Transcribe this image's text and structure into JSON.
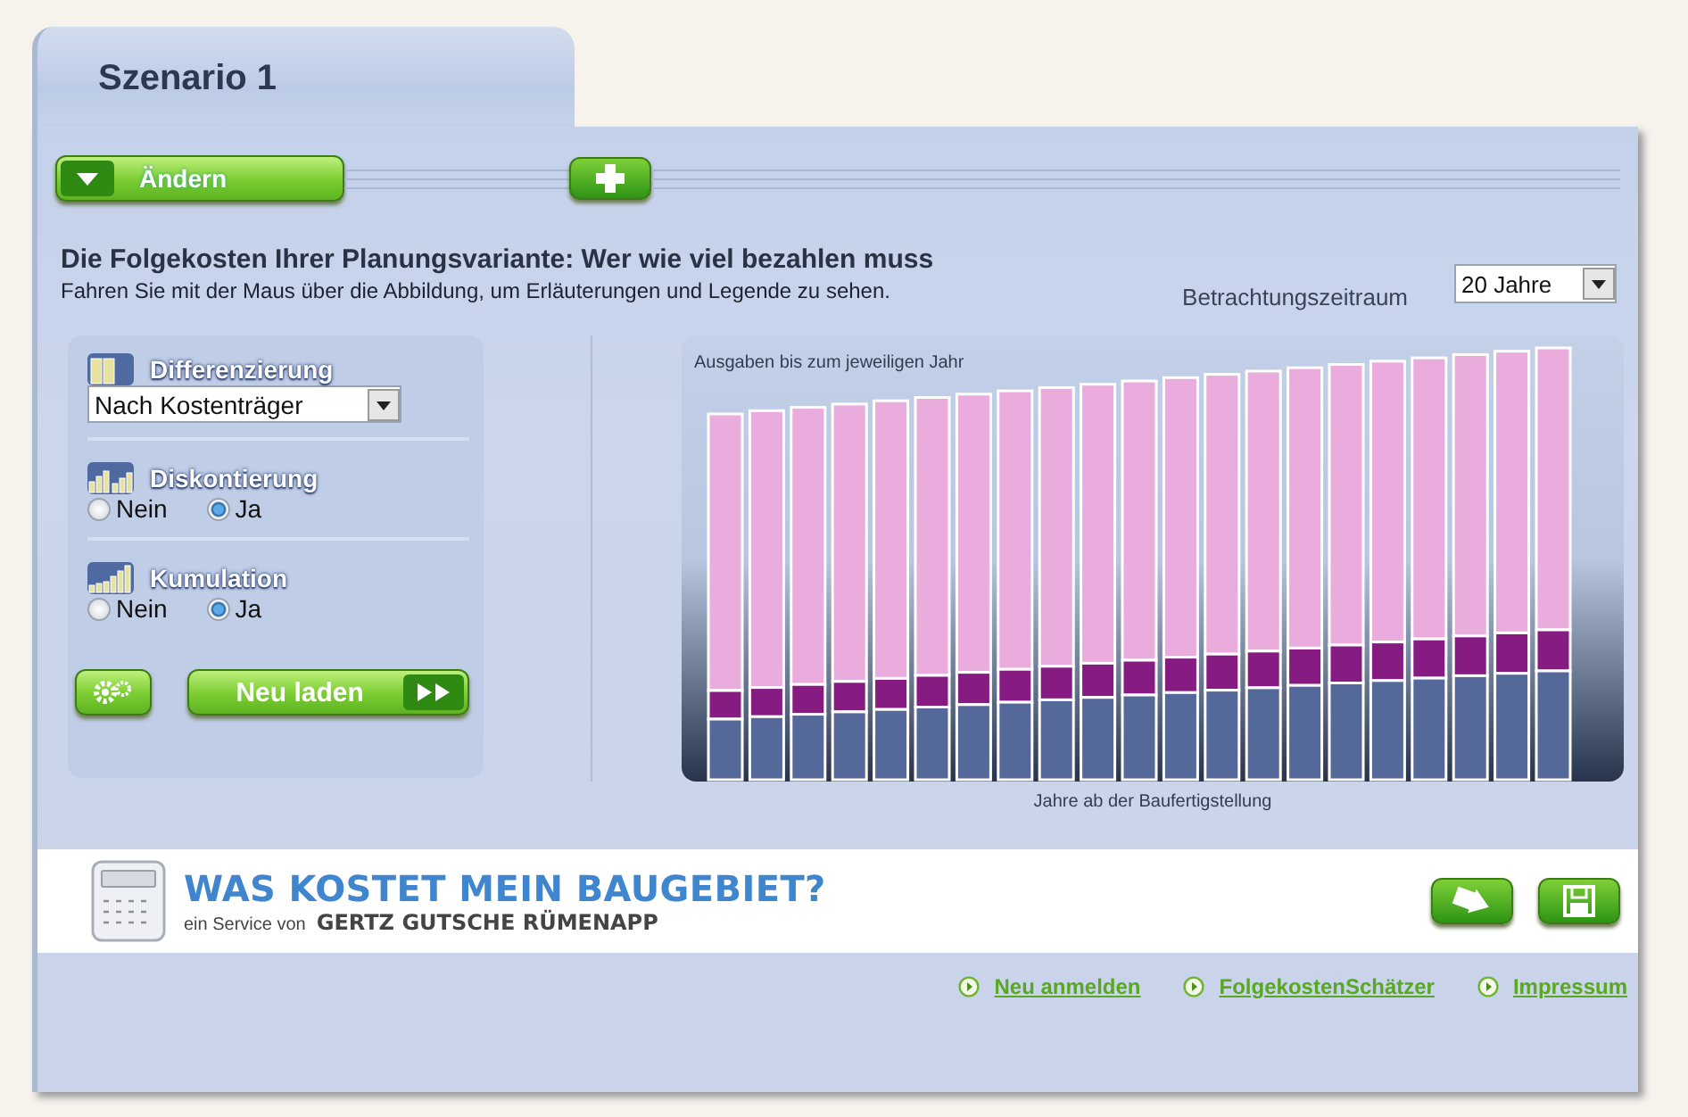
{
  "tab": {
    "title": "Szenario 1"
  },
  "toolbar": {
    "change_button": "Ändern"
  },
  "heading": "Die Folgekosten Ihrer Planungsvariante: Wer wie viel bezahlen muss",
  "subtitle": "Fahren Sie mit der Maus über die Abbildung, um Erläuterungen und Legende zu sehen.",
  "period": {
    "label": "Betrachtungszeitraum",
    "value": "20 Jahre"
  },
  "options": [
    {
      "kind": "select",
      "label": "Differenzierung",
      "value": "Nach Kostenträger"
    },
    {
      "kind": "radio",
      "label": "Diskontierung",
      "choices": [
        {
          "label": "Nein",
          "selected": false
        },
        {
          "label": "Ja",
          "selected": true
        }
      ]
    },
    {
      "kind": "radio",
      "label": "Kumulation",
      "choices": [
        {
          "label": "Nein",
          "selected": false
        },
        {
          "label": "Ja",
          "selected": true
        }
      ]
    }
  ],
  "reload_button": "Neu laden",
  "chart": {
    "title": "Ausgaben bis zum jeweiligen Jahr",
    "xlabel": "Jahre ab der Baufertigstellung"
  },
  "brand": {
    "title": "WAS KOSTET MEIN BAUGEBIET?",
    "service": "ein Service von",
    "company": "GERTZ GUTSCHE RÜMENAPP"
  },
  "links": [
    "Neu anmelden",
    "FolgekostenSchätzer",
    "Impressum"
  ]
}
